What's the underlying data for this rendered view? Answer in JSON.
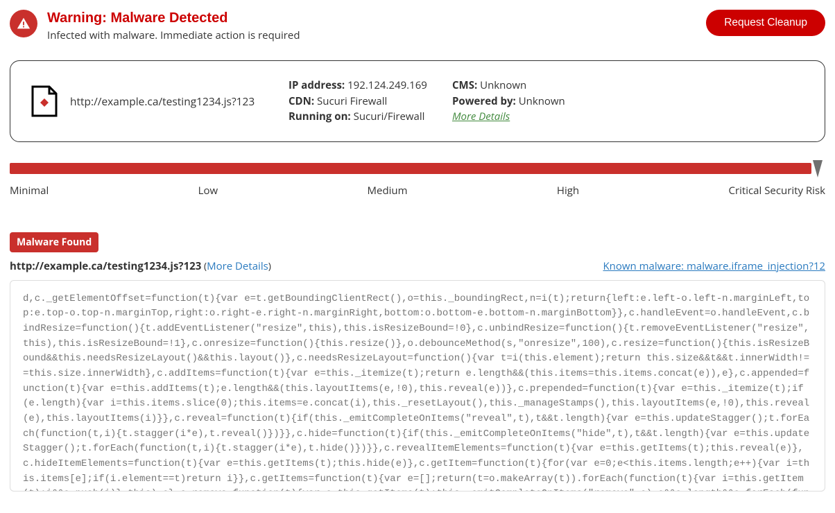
{
  "header": {
    "title": "Warning: Malware Detected",
    "subtitle": "Infected with malware. Immediate action is required",
    "request_button_label": "Request Cleanup"
  },
  "site_info": {
    "url": "http://example.ca/testing1234.js?123",
    "ip_label": "IP address:",
    "ip_value": "192.124.249.169",
    "cdn_label": "CDN:",
    "cdn_value": "Sucuri Firewall",
    "running_on_label": "Running on:",
    "running_on_value": "Sucuri/Firewall",
    "cms_label": "CMS:",
    "cms_value": "Unknown",
    "powered_by_label": "Powered by:",
    "powered_by_value": "Unknown",
    "more_details_label": "More Details"
  },
  "risk": {
    "labels": [
      "Minimal",
      "Low",
      "Medium",
      "High",
      "Critical Security Risk"
    ]
  },
  "finding": {
    "badge": "Malware Found",
    "url": "http://example.ca/testing1234.js?123",
    "more_details_text": "More Details",
    "known_malware_text": "Known malware: malware.iframe_injection?12",
    "code_sample": "d,c._getElementOffset=function(t){var e=t.getBoundingClientRect(),o=this._boundingRect,n=i(t);return{left:e.left-o.left-n.marginLeft,top:e.top-o.top-n.marginTop,right:o.right-e.right-n.marginRight,bottom:o.bottom-e.bottom-n.marginBottom}},c.handleEvent=o.handleEvent,c.bindResize=function(){t.addEventListener(\"resize\",this),this.isResizeBound=!0},c.unbindResize=function(){t.removeEventListener(\"resize\",this),this.isResizeBound=!1},c.onresize=function(){this.resize()},o.debounceMethod(s,\"onresize\",100),c.resize=function(){this.isResizeBound&&this.needsResizeLayout()&&this.layout()},c.needsResizeLayout=function(){var t=i(this.element);return this.size&&t&&t.innerWidth!==this.size.innerWidth},c.addItems=function(t){var e=this._itemize(t);return e.length&&(this.items=this.items.concat(e)),e},c.appended=function(t){var e=this.addItems(t);e.length&&(this.layoutItems(e,!0),this.reveal(e))},c.prepended=function(t){var e=this._itemize(t);if(e.length){var i=this.items.slice(0);this.items=e.concat(i),this._resetLayout(),this._manageStamps(),this.layoutItems(e,!0),this.reveal(e),this.layoutItems(i)}},c.reveal=function(t){if(this._emitCompleteOnItems(\"reveal\",t),t&&t.length){var e=this.updateStagger();t.forEach(function(t,i){t.stagger(i*e),t.reveal()})}},c.hide=function(t){if(this._emitCompleteOnItems(\"hide\",t),t&&t.length){var e=this.updateStagger();t.forEach(function(t,i){t.stagger(i*e),t.hide()})}},c.revealItemElements=function(t){var e=this.getItems(t);this.reveal(e)},c.hideItemElements=function(t){var e=this.getItems(t);this.hide(e)},c.getItem=function(t){for(var e=0;e<this.items.length;e++){var i=this.items[e];if(i.element==t)return i}},c.getItems=function(t){var e=[];return(t=o.makeArray(t)).forEach(function(t){var i=this.getItem(t);i&&e.push(i)},this),e},c.remove=function(t){var e=this.getItems(t);this._emitCompleteOnItems(\"remove\",e),e&&e.length&&e.forEach(function(t){t.remove(),o.removeFrom(this.items,t)},this)},c.destroy=function(){var t=this.element.styl"
  }
}
